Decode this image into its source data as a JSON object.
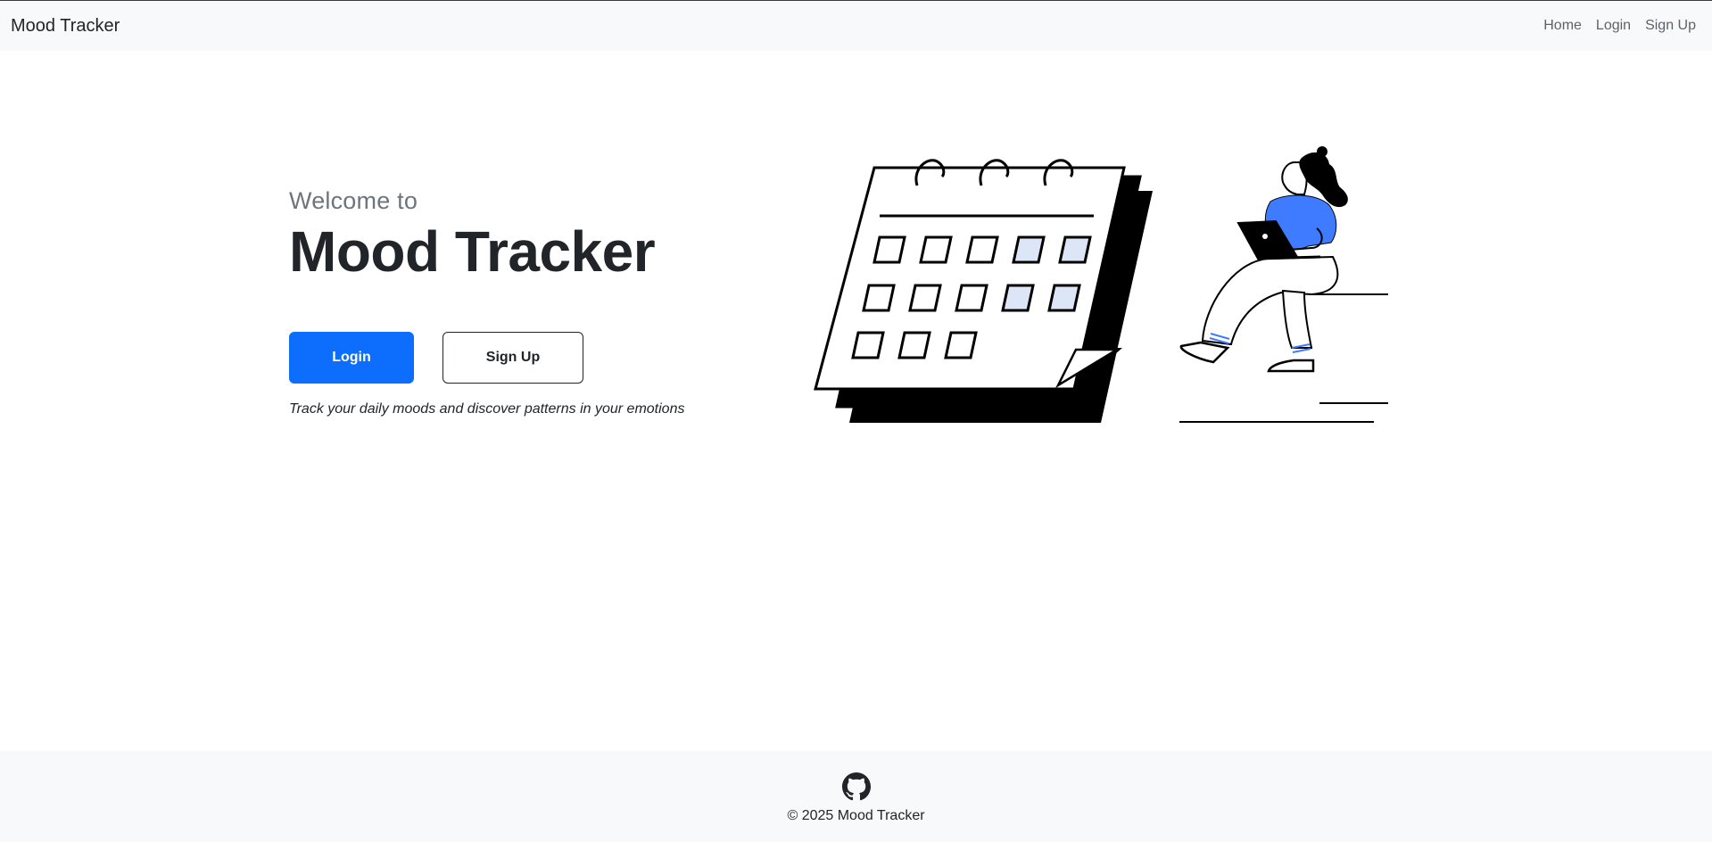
{
  "navbar": {
    "brand": "Mood Tracker",
    "links": [
      "Home",
      "Login",
      "Sign Up"
    ]
  },
  "hero": {
    "welcome": "Welcome to",
    "title": "Mood Tracker",
    "login_label": "Login",
    "signup_label": "Sign Up",
    "tagline": "Track your daily moods and discover patterns in your emotions"
  },
  "footer": {
    "copyright": "© 2025 Mood Tracker",
    "github_icon": "github-icon"
  },
  "colors": {
    "primary": "#0d6efd",
    "navbar_bg": "#f8f9fa",
    "illustration_accent": "#3f7bff",
    "calendar_highlight": "#dce6f7"
  }
}
